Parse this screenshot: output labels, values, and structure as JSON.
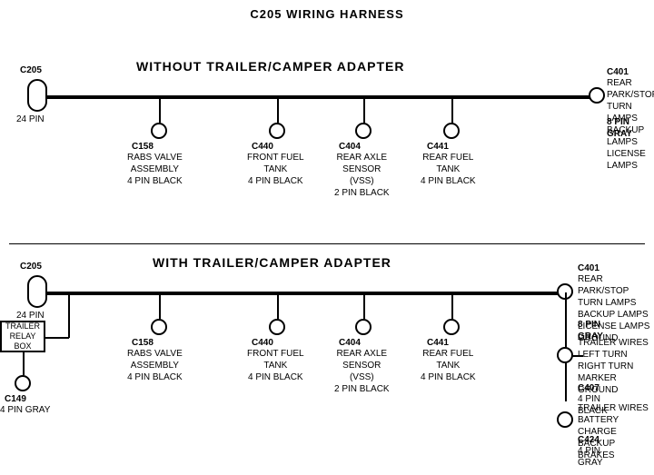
{
  "title": "C205 WIRING HARNESS",
  "top_section": {
    "label": "WITHOUT  TRAILER/CAMPER  ADAPTER",
    "left_connector": {
      "id": "C205",
      "sub": "24 PIN"
    },
    "right_connector": {
      "id": "C401",
      "sub": "8 PIN\nGRAY",
      "description": "REAR PARK/STOP\nTURN LAMPS\nBACKUP LAMPS\nLICENSE LAMPS"
    },
    "connectors": [
      {
        "id": "C158",
        "desc": "RABS VALVE\nASSEMBLY\n4 PIN BLACK"
      },
      {
        "id": "C440",
        "desc": "FRONT FUEL\nTANK\n4 PIN BLACK"
      },
      {
        "id": "C404",
        "desc": "REAR AXLE\nSENSOR\n(VSS)\n2 PIN BLACK"
      },
      {
        "id": "C441",
        "desc": "REAR FUEL\nTANK\n4 PIN BLACK"
      }
    ]
  },
  "bottom_section": {
    "label": "WITH  TRAILER/CAMPER  ADAPTER",
    "left_connector": {
      "id": "C205",
      "sub": "24 PIN"
    },
    "right_connector": {
      "id": "C401",
      "sub": "8 PIN\nGRAY",
      "description": "REAR PARK/STOP\nTURN LAMPS\nBACKUP LAMPS\nLICENSE LAMPS\nGROUND"
    },
    "extra_left": {
      "box_label": "TRAILER\nRELAY\nBOX",
      "connector_id": "C149",
      "connector_sub": "4 PIN GRAY"
    },
    "connectors": [
      {
        "id": "C158",
        "desc": "RABS VALVE\nASSEMBLY\n4 PIN BLACK"
      },
      {
        "id": "C440",
        "desc": "FRONT FUEL\nTANK\n4 PIN BLACK"
      },
      {
        "id": "C404",
        "desc": "REAR AXLE\nSENSOR\n(VSS)\n2 PIN BLACK"
      },
      {
        "id": "C441",
        "desc": "REAR FUEL\nTANK\n4 PIN BLACK"
      }
    ],
    "right_extra": [
      {
        "connector_id": "C407",
        "connector_sub": "4 PIN\nBLACK",
        "description": "TRAILER WIRES\nLEFT TURN\nRIGHT TURN\nMARKER\nGROUND"
      },
      {
        "connector_id": "C424",
        "connector_sub": "4 PIN\nGRAY",
        "description": "TRAILER WIRES\nBATTERY CHARGE\nBACKUP\nBRAKES"
      }
    ]
  }
}
